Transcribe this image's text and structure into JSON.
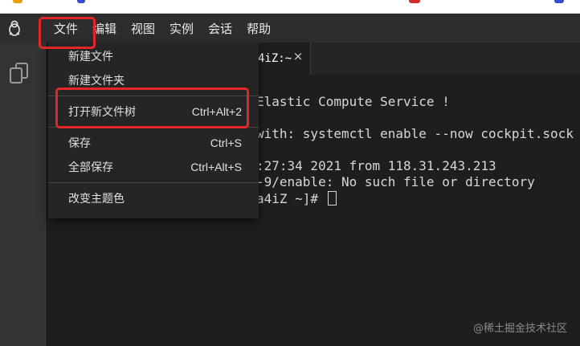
{
  "menubar": {
    "logo_icon": "penguin-icon",
    "items": [
      "文件",
      "编辑",
      "视图",
      "实例",
      "会话",
      "帮助"
    ]
  },
  "sidebar": {
    "icon": "copy-files-icon"
  },
  "tab": {
    "title": "4iZ:~",
    "close": "×"
  },
  "terminal": {
    "lines": [
      "Elastic Compute Service !",
      "with: systemctl enable --now cockpit.sock",
      ":27:34 2021 from 118.31.243.213",
      "-9/enable: No such file or directory",
      "a4iZ ~]# "
    ]
  },
  "file_menu": {
    "new_file": "新建文件",
    "new_folder": "新建文件夹",
    "open_tree": "打开新文件树",
    "open_tree_shortcut": "Ctrl+Alt+2",
    "save": "保存",
    "save_shortcut": "Ctrl+S",
    "save_all": "全部保存",
    "save_all_shortcut": "Ctrl+Alt+S",
    "change_theme": "改变主题色"
  },
  "watermark": "@稀土掘金技术社区",
  "colors": {
    "annotation_red": "#e3262a",
    "menubar_bg": "#2d2d30",
    "dropdown_bg": "#252526",
    "terminal_bg": "#1e1e1e"
  }
}
